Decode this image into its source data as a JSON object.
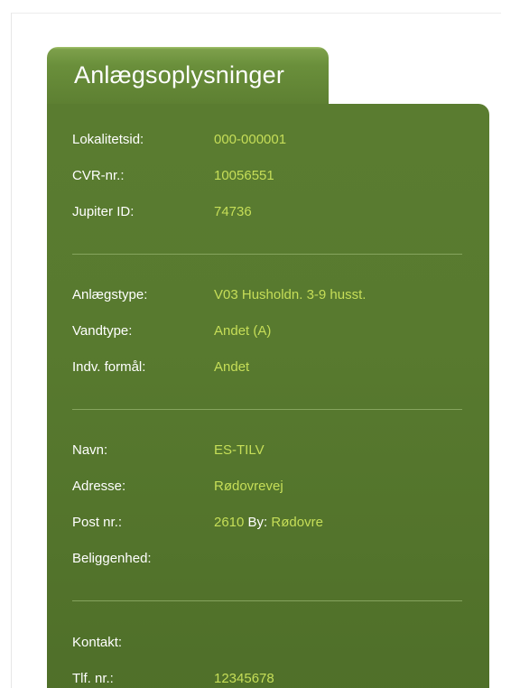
{
  "panel": {
    "title": "Anlægsoplysninger"
  },
  "fields": {
    "lokalitetsid": {
      "label": "Lokalitetsid:",
      "value": "000-000001"
    },
    "cvr": {
      "label": "CVR-nr.:",
      "value": "10056551"
    },
    "jupiter_id": {
      "label": "Jupiter ID:",
      "value": "74736"
    },
    "anlaegstype": {
      "label": "Anlægstype:",
      "value": "V03 Husholdn. 3-9 husst."
    },
    "vandtype": {
      "label": "Vandtype:",
      "value": "Andet (A)"
    },
    "indv_formaal": {
      "label": "Indv. formål:",
      "value": "Andet"
    },
    "navn": {
      "label": "Navn:",
      "value": "ES-TILV"
    },
    "adresse": {
      "label": "Adresse:",
      "value": "Rødovrevej"
    },
    "post_nr": {
      "label": "Post nr.:",
      "value": "2610",
      "by_label": "By:",
      "by_value": "Rødovre"
    },
    "beliggenhed": {
      "label": "Beliggenhed:"
    },
    "kontakt": {
      "label": "Kontakt:"
    },
    "tlf": {
      "label": "Tlf. nr.:",
      "value": "12345678"
    }
  },
  "colors": {
    "panel_green": "#587a2f",
    "tab_green": "#6a8f3b",
    "value_yellow_green": "#c6de58",
    "label_white": "#ffffff"
  }
}
